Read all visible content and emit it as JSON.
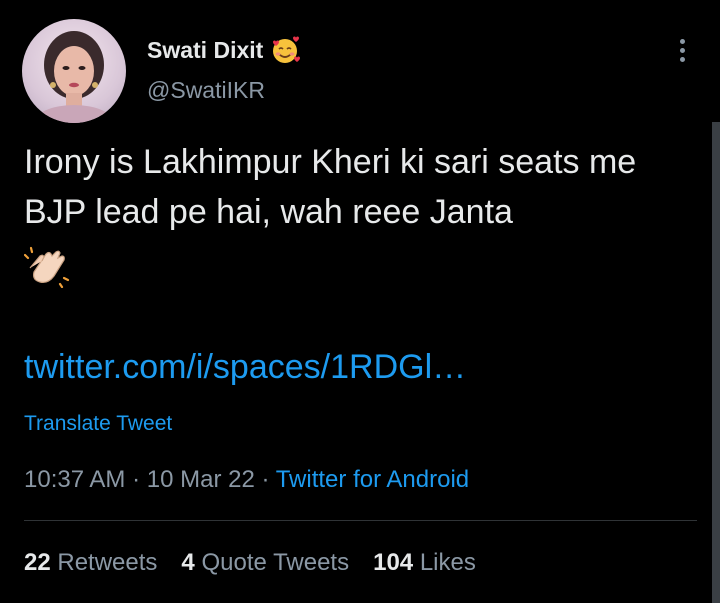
{
  "author": {
    "display_name": "Swati Dixit",
    "handle": "@SwatiIKR",
    "badge_emoji": "smiling-face-with-hearts"
  },
  "tweet": {
    "text": "Irony is Lakhimpur Kheri ki sari seats me BJP lead pe hai, wah reee Janta",
    "trailing_emoji": "clapping-hands",
    "link": "twitter.com/i/spaces/1RDGl…",
    "translate_label": "Translate Tweet"
  },
  "meta": {
    "time": "10:37 AM",
    "separator": "·",
    "date": "10 Mar 22",
    "source": "Twitter for Android"
  },
  "stats": {
    "retweets_count": "22",
    "retweets_label": "Retweets",
    "quotes_count": "4",
    "quotes_label": "Quote Tweets",
    "likes_count": "104",
    "likes_label": "Likes"
  },
  "colors": {
    "background": "#000000",
    "text": "#e7e9ea",
    "muted": "#8b98a5",
    "accent": "#1d9bf0",
    "divider": "#2f3336"
  }
}
